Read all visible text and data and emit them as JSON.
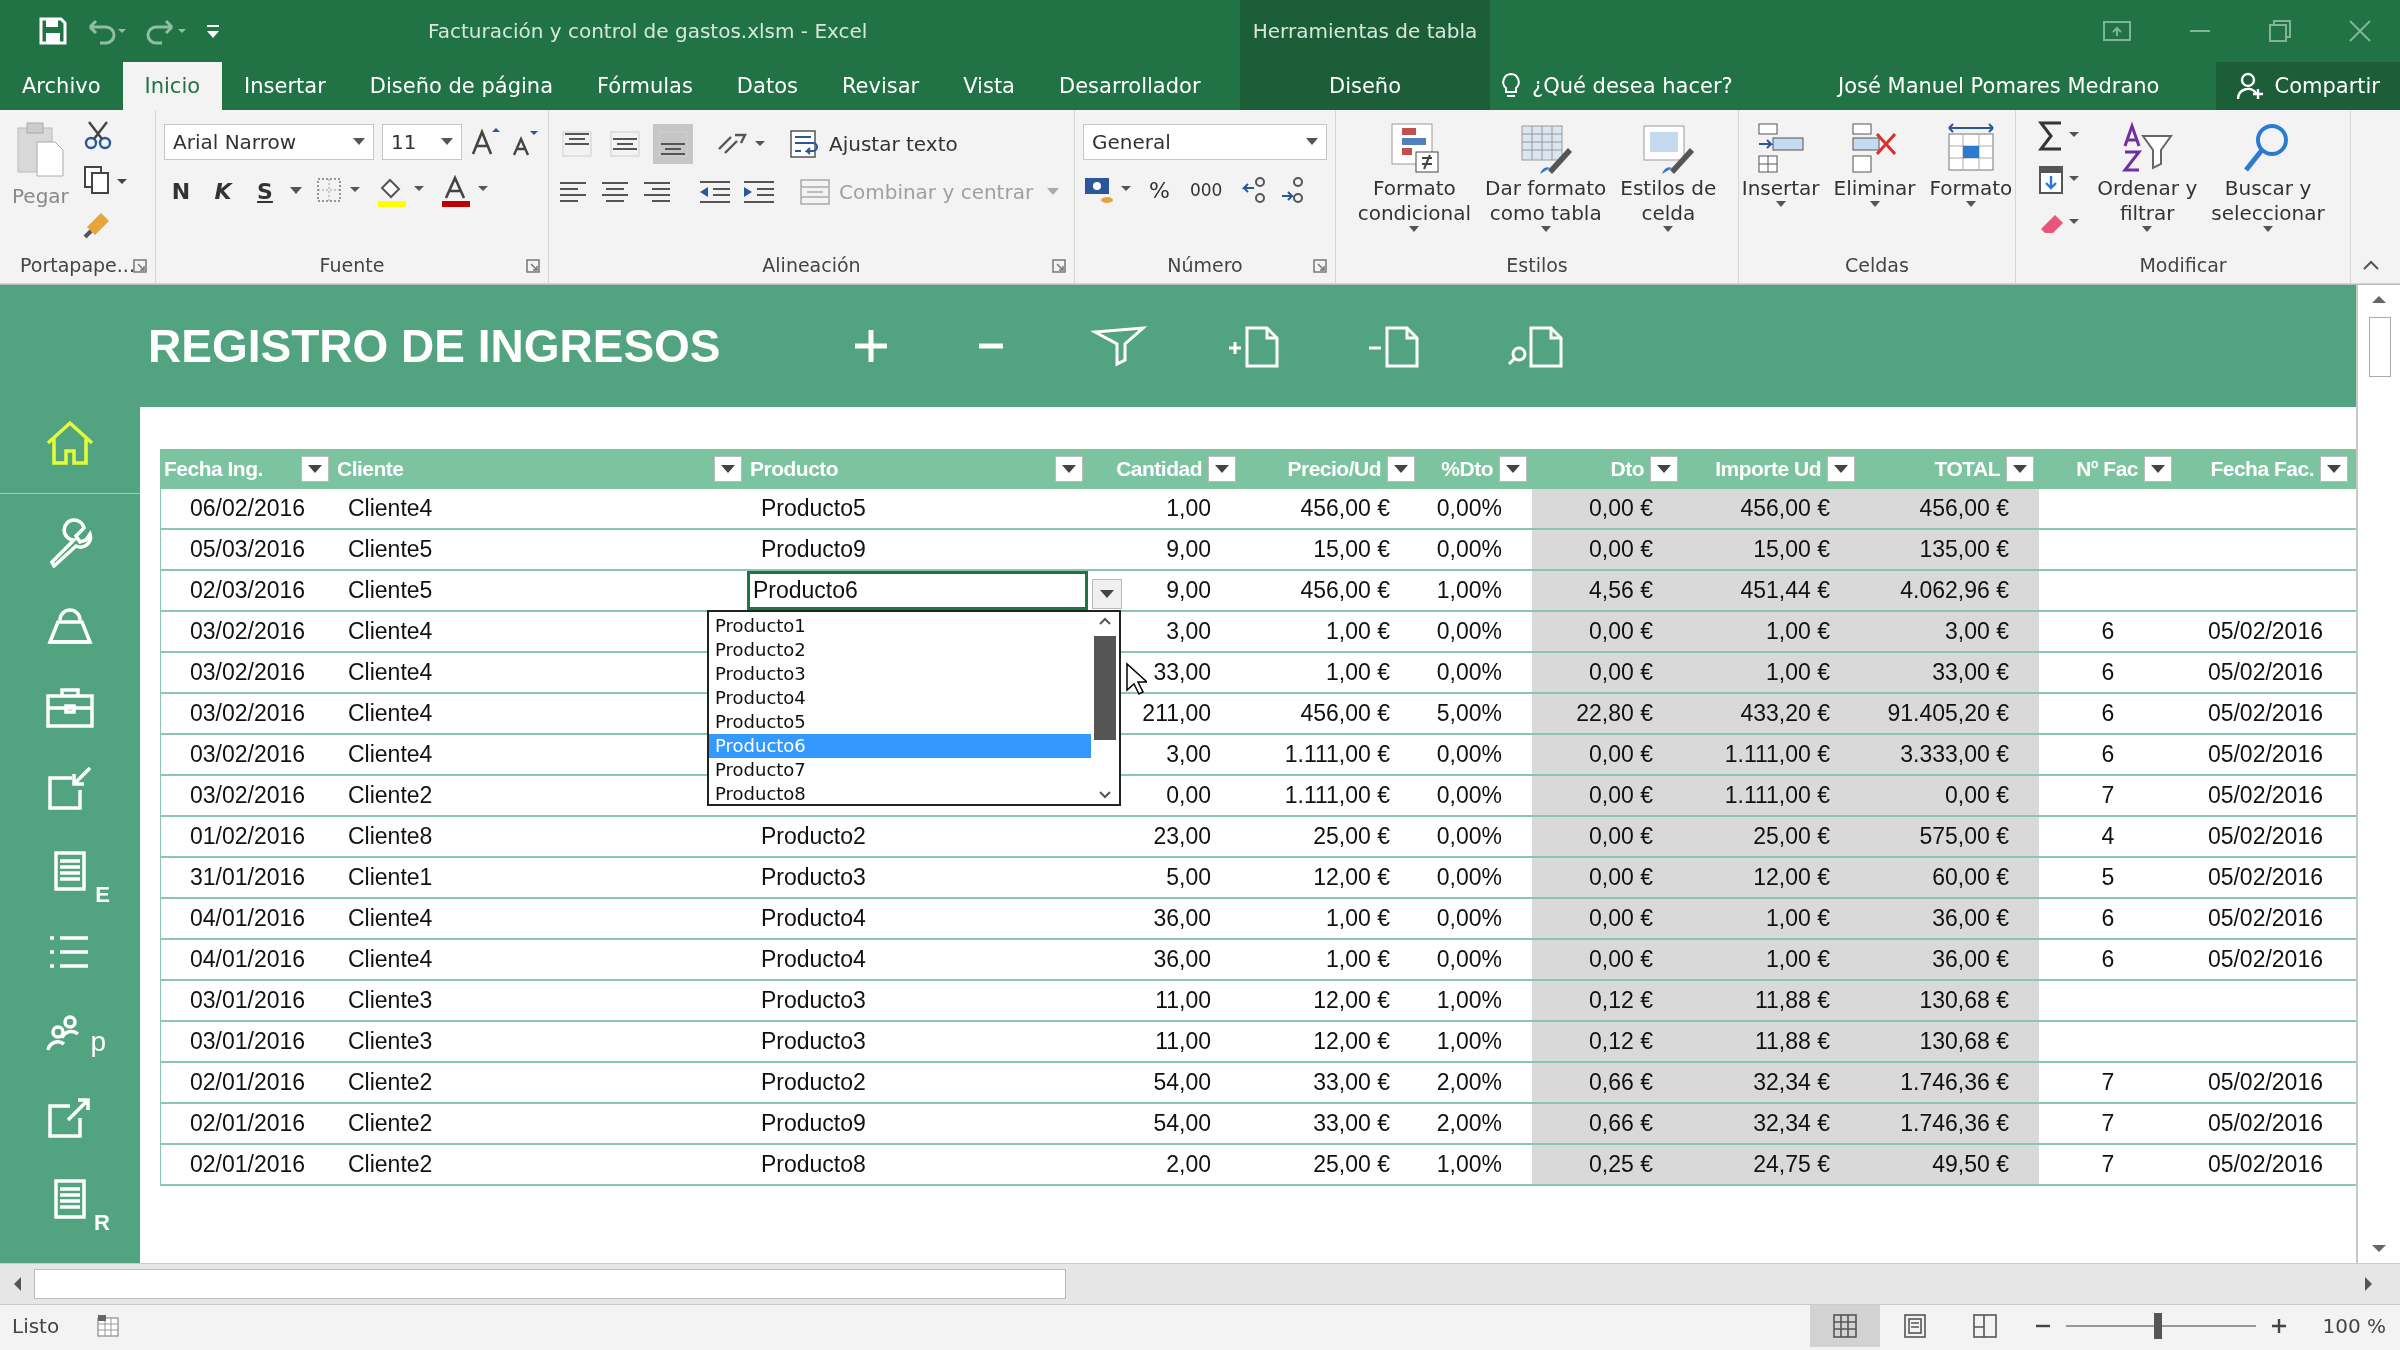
{
  "window": {
    "title": "Facturación y control de gastos.xlsm - Excel",
    "context_title": "Herramientas de tabla"
  },
  "tabs": [
    {
      "label": "Archivo",
      "selected": false
    },
    {
      "label": "Inicio",
      "selected": true
    },
    {
      "label": "Insertar",
      "selected": false
    },
    {
      "label": "Diseño de página",
      "selected": false
    },
    {
      "label": "Fórmulas",
      "selected": false
    },
    {
      "label": "Datos",
      "selected": false
    },
    {
      "label": "Revisar",
      "selected": false
    },
    {
      "label": "Vista",
      "selected": false
    },
    {
      "label": "Desarrollador",
      "selected": false
    }
  ],
  "context_tabs": [
    {
      "label": "Diseño",
      "selected": false
    }
  ],
  "tell_me": {
    "placeholder": "¿Qué desea hacer?"
  },
  "user": "José Manuel Pomares Medrano",
  "share_button": "Compartir",
  "ribbon": {
    "clipboard": {
      "label": "Portapape...",
      "paste": "Pegar"
    },
    "font": {
      "label": "Fuente",
      "name": "Arial Narrow",
      "size": "11",
      "bold": "N",
      "italic": "K",
      "underline": "S"
    },
    "alignment": {
      "label": "Alineación",
      "vertical": [
        {
          "kind": "top",
          "selected": false
        },
        {
          "kind": "middle",
          "selected": false
        },
        {
          "kind": "bottom",
          "selected": true
        }
      ],
      "wrap": "Ajustar texto",
      "merge": {
        "label": "Combinar y centrar",
        "disabled": true
      }
    },
    "number": {
      "label": "Número",
      "format": "General",
      "percent": "%",
      "thousands": "000"
    },
    "styles": {
      "label": "Estilos",
      "buttons": [
        {
          "kind": "conditional",
          "lines": [
            "Formato",
            "condicional"
          ]
        },
        {
          "kind": "table",
          "lines": [
            "Dar formato",
            "como tabla"
          ]
        },
        {
          "kind": "cellstyle",
          "lines": [
            "Estilos de",
            "celda"
          ]
        }
      ]
    },
    "cells": {
      "label": "Celdas",
      "buttons": [
        {
          "kind": "insert",
          "lines": [
            "Insertar"
          ]
        },
        {
          "kind": "delete",
          "lines": [
            "Eliminar"
          ]
        },
        {
          "kind": "format",
          "lines": [
            "Formato"
          ]
        }
      ]
    },
    "editing": {
      "label": "Modificar",
      "buttons": [
        {
          "kind": "sort",
          "lines": [
            "Ordenar y",
            "filtrar"
          ]
        },
        {
          "kind": "find",
          "lines": [
            "Buscar y",
            "seleccionar"
          ]
        }
      ]
    }
  },
  "sheet": {
    "title": "REGISTRO DE INGRESOS",
    "sidebar": [
      {
        "kind": "home",
        "selected": true
      },
      {
        "kind": "wrench",
        "selected": false
      },
      {
        "kind": "bag",
        "selected": false
      },
      {
        "kind": "briefcase",
        "selected": false
      },
      {
        "kind": "import",
        "selected": false
      },
      {
        "kind": "sheet",
        "letter": "E",
        "selected": false
      },
      {
        "kind": "list",
        "selected": false
      },
      {
        "kind": "people",
        "letter": "p",
        "selected": false
      },
      {
        "kind": "export",
        "selected": false
      },
      {
        "kind": "sheet",
        "letter": "R",
        "selected": false
      }
    ],
    "table": {
      "columns": [
        {
          "label": "Fecha Ing."
        },
        {
          "label": "Cliente"
        },
        {
          "label": "Producto"
        },
        {
          "label": "Cantidad"
        },
        {
          "label": "Precio/Ud"
        },
        {
          "label": "%Dto"
        },
        {
          "label": "Dto"
        },
        {
          "label": "Importe Ud"
        },
        {
          "label": "TOTAL"
        },
        {
          "label": "Nº Fac"
        },
        {
          "label": "Fecha Fac."
        }
      ],
      "rows": [
        {
          "selected": false,
          "fecha_ing": "06/02/2016",
          "cliente": "Cliente4",
          "producto": "Producto5",
          "cantidad": "1,00",
          "precio_ud": "456,00 €",
          "pct_dto": "0,00%",
          "dto": "0,00 €",
          "importe_ud": "456,00 €",
          "total": "456,00 €"
        },
        {
          "selected": false,
          "fecha_ing": "05/03/2016",
          "cliente": "Cliente5",
          "producto": "Producto9",
          "cantidad": "9,00",
          "precio_ud": "15,00 €",
          "pct_dto": "0,00%",
          "dto": "0,00 €",
          "importe_ud": "15,00 €",
          "total": "135,00 €"
        },
        {
          "selected": true,
          "fecha_ing": "02/03/2016",
          "cliente": "Cliente5",
          "producto": "Producto6",
          "cantidad": "9,00",
          "precio_ud": "456,00 €",
          "pct_dto": "1,00%",
          "dto": "4,56 €",
          "importe_ud": "451,44 €",
          "total": "4.062,96 €"
        },
        {
          "selected": false,
          "fecha_ing": "03/02/2016",
          "cliente": "Cliente4",
          "cantidad": "3,00",
          "precio_ud": "1,00 €",
          "pct_dto": "0,00%",
          "dto": "0,00 €",
          "importe_ud": "1,00 €",
          "total": "3,00 €",
          "n_fac": "6",
          "fecha_fac": "05/02/2016"
        },
        {
          "selected": false,
          "fecha_ing": "03/02/2016",
          "cliente": "Cliente4",
          "cantidad": "33,00",
          "precio_ud": "1,00 €",
          "pct_dto": "0,00%",
          "dto": "0,00 €",
          "importe_ud": "1,00 €",
          "total": "33,00 €",
          "n_fac": "6",
          "fecha_fac": "05/02/2016"
        },
        {
          "selected": false,
          "fecha_ing": "03/02/2016",
          "cliente": "Cliente4",
          "cantidad": "211,00",
          "precio_ud": "456,00 €",
          "pct_dto": "5,00%",
          "dto": "22,80 €",
          "importe_ud": "433,20 €",
          "total": "91.405,20 €",
          "n_fac": "6",
          "fecha_fac": "05/02/2016"
        },
        {
          "selected": false,
          "fecha_ing": "03/02/2016",
          "cliente": "Cliente4",
          "cantidad": "3,00",
          "precio_ud": "1.111,00 €",
          "pct_dto": "0,00%",
          "dto": "0,00 €",
          "importe_ud": "1.111,00 €",
          "total": "3.333,00 €",
          "n_fac": "6",
          "fecha_fac": "05/02/2016"
        },
        {
          "selected": false,
          "fecha_ing": "03/02/2016",
          "cliente": "Cliente2",
          "cantidad": "0,00",
          "precio_ud": "1.111,00 €",
          "pct_dto": "0,00%",
          "dto": "0,00 €",
          "importe_ud": "1.111,00 €",
          "total": "0,00 €",
          "n_fac": "7",
          "fecha_fac": "05/02/2016"
        },
        {
          "selected": false,
          "fecha_ing": "01/02/2016",
          "cliente": "Cliente8",
          "producto": "Producto2",
          "cantidad": "23,00",
          "precio_ud": "25,00 €",
          "pct_dto": "0,00%",
          "dto": "0,00 €",
          "importe_ud": "25,00 €",
          "total": "575,00 €",
          "n_fac": "4",
          "fecha_fac": "05/02/2016"
        },
        {
          "selected": false,
          "fecha_ing": "31/01/2016",
          "cliente": "Cliente1",
          "producto": "Producto3",
          "cantidad": "5,00",
          "precio_ud": "12,00 €",
          "pct_dto": "0,00%",
          "dto": "0,00 €",
          "importe_ud": "12,00 €",
          "total": "60,00 €",
          "n_fac": "5",
          "fecha_fac": "05/02/2016"
        },
        {
          "selected": false,
          "fecha_ing": "04/01/2016",
          "cliente": "Cliente4",
          "producto": "Producto4",
          "cantidad": "36,00",
          "precio_ud": "1,00 €",
          "pct_dto": "0,00%",
          "dto": "0,00 €",
          "importe_ud": "1,00 €",
          "total": "36,00 €",
          "n_fac": "6",
          "fecha_fac": "05/02/2016"
        },
        {
          "selected": false,
          "fecha_ing": "04/01/2016",
          "cliente": "Cliente4",
          "producto": "Producto4",
          "cantidad": "36,00",
          "precio_ud": "1,00 €",
          "pct_dto": "0,00%",
          "dto": "0,00 €",
          "importe_ud": "1,00 €",
          "total": "36,00 €",
          "n_fac": "6",
          "fecha_fac": "05/02/2016"
        },
        {
          "selected": false,
          "fecha_ing": "03/01/2016",
          "cliente": "Cliente3",
          "producto": "Producto3",
          "cantidad": "11,00",
          "precio_ud": "12,00 €",
          "pct_dto": "1,00%",
          "dto": "0,12 €",
          "importe_ud": "11,88 €",
          "total": "130,68 €"
        },
        {
          "selected": false,
          "fecha_ing": "03/01/2016",
          "cliente": "Cliente3",
          "producto": "Producto3",
          "cantidad": "11,00",
          "precio_ud": "12,00 €",
          "pct_dto": "1,00%",
          "dto": "0,12 €",
          "importe_ud": "11,88 €",
          "total": "130,68 €"
        },
        {
          "selected": false,
          "fecha_ing": "02/01/2016",
          "cliente": "Cliente2",
          "producto": "Producto2",
          "cantidad": "54,00",
          "precio_ud": "33,00 €",
          "pct_dto": "2,00%",
          "dto": "0,66 €",
          "importe_ud": "32,34 €",
          "total": "1.746,36 €",
          "n_fac": "7",
          "fecha_fac": "05/02/2016"
        },
        {
          "selected": false,
          "fecha_ing": "02/01/2016",
          "cliente": "Cliente2",
          "producto": "Producto9",
          "cantidad": "54,00",
          "precio_ud": "33,00 €",
          "pct_dto": "2,00%",
          "dto": "0,66 €",
          "importe_ud": "32,34 €",
          "total": "1.746,36 €",
          "n_fac": "7",
          "fecha_fac": "05/02/2016"
        },
        {
          "selected": false,
          "fecha_ing": "02/01/2016",
          "cliente": "Cliente2",
          "producto": "Producto8",
          "cantidad": "2,00",
          "precio_ud": "25,00 €",
          "pct_dto": "1,00%",
          "dto": "0,25 €",
          "importe_ud": "24,75 €",
          "total": "49,50 €",
          "n_fac": "7",
          "fecha_fac": "05/02/2016"
        }
      ]
    },
    "dropdown": {
      "items": [
        {
          "label": "Producto1",
          "selected": false
        },
        {
          "label": "Producto2",
          "selected": false
        },
        {
          "label": "Producto3",
          "selected": false
        },
        {
          "label": "Producto4",
          "selected": false
        },
        {
          "label": "Producto5",
          "selected": false
        },
        {
          "label": "Producto6",
          "selected": true
        },
        {
          "label": "Producto7",
          "selected": false
        },
        {
          "label": "Producto8",
          "selected": false
        }
      ]
    }
  },
  "status_bar": {
    "status": "Listo",
    "views": [
      {
        "kind": "normal",
        "selected": true
      },
      {
        "kind": "page_layout",
        "selected": false
      },
      {
        "kind": "page_break",
        "selected": false
      }
    ],
    "zoom": {
      "level": 0.48,
      "reading": "100 %"
    }
  }
}
